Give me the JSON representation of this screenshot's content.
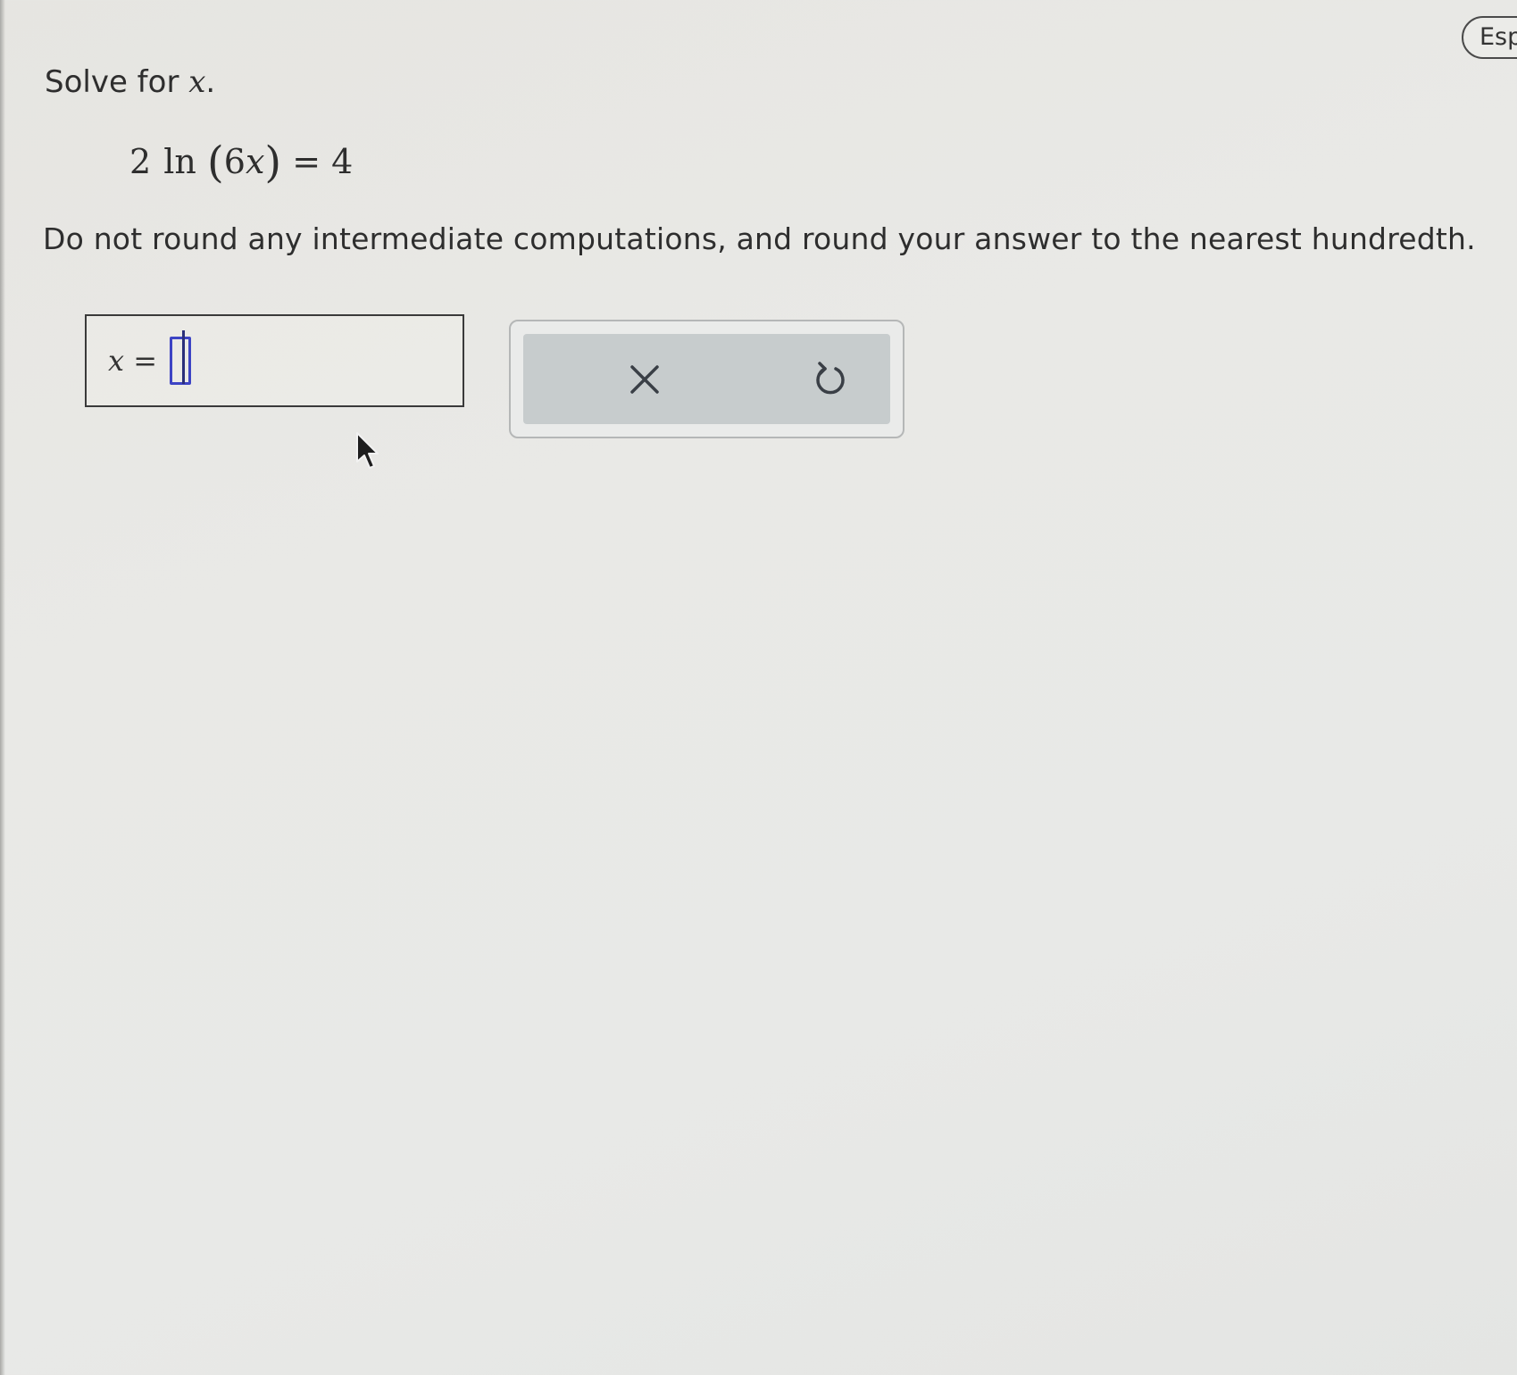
{
  "language_button": {
    "label": "Esp"
  },
  "question": {
    "prompt_text": "Solve for ",
    "prompt_var": "x",
    "prompt_end": ".",
    "equation": {
      "coefficient": "2",
      "function": "ln",
      "open_paren": "(",
      "inner_coef": "6",
      "inner_var": "x",
      "close_paren": ")",
      "equals": "=",
      "rhs": "4"
    },
    "instruction": "Do not round any intermediate computations, and round your answer to the nearest hundredth."
  },
  "answer": {
    "label": "x =",
    "value": ""
  },
  "toolbar": {
    "clear_icon": "close-icon",
    "undo_icon": "undo-icon"
  },
  "colors": {
    "input_border": "#3d44c4",
    "toolbar_bg": "#c7cccd",
    "background": "#e8e8e5"
  }
}
